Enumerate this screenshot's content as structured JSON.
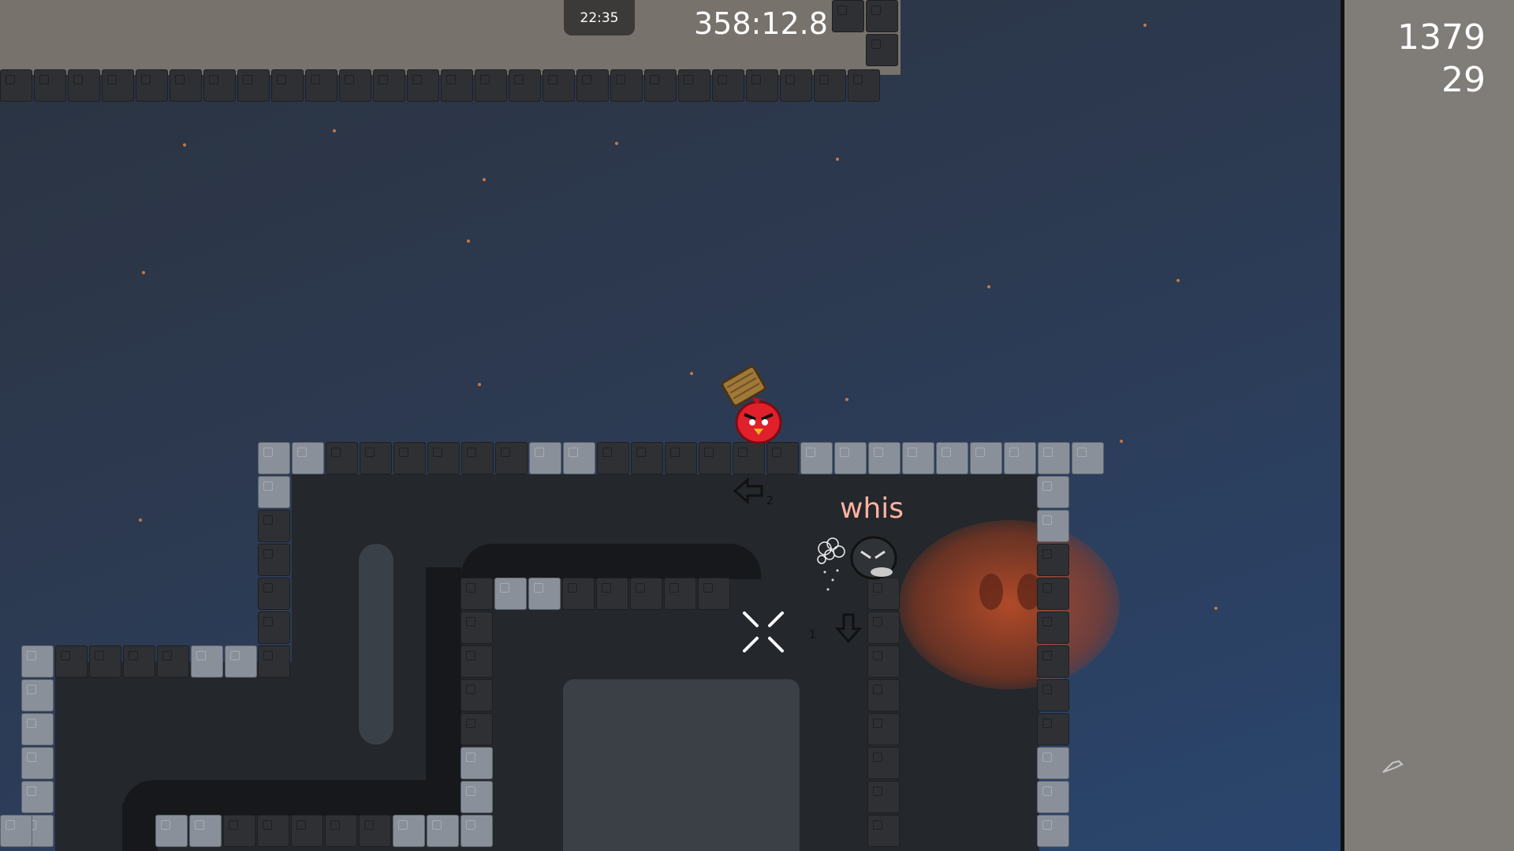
{
  "hud": {
    "clock": "22:35",
    "race_timer": "358:12.8",
    "score_line_1": "1379",
    "score_line_2": "29"
  },
  "players": [
    {
      "name": "whis"
    }
  ],
  "markers": {
    "arrow_left_number": "2",
    "arrow_down_number": "1"
  },
  "colors": {
    "sky": "#2c3a52",
    "player_name": "#ffb3a1",
    "star": "#c57845",
    "freeze_area": "#77726c"
  },
  "icons": [
    "left-arrow-icon",
    "down-arrow-icon",
    "crosshair-icon",
    "red-bird-tee-icon",
    "dark-tee-icon",
    "hammer-icon"
  ]
}
